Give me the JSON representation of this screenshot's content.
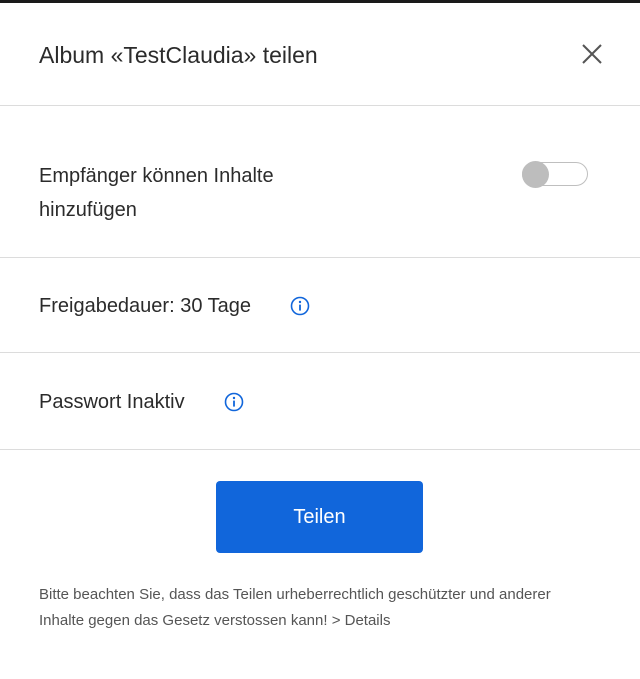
{
  "dialog": {
    "title": "Album «TestClaudia» teilen",
    "close_icon": "close-icon"
  },
  "options": {
    "contributors": {
      "label": "Empfänger können Inhalte hinzufügen",
      "toggle_on": false
    },
    "duration": {
      "label": "Freigabedauer: 30 Tage",
      "icon": "info-icon"
    },
    "password": {
      "label": "Passwort Inaktiv",
      "icon": "info-icon"
    }
  },
  "actions": {
    "share_label": "Teilen"
  },
  "notice": {
    "text": "Bitte beachten Sie, dass das Teilen urheberrechtlich geschützter und anderer Inhalte gegen das Gesetz verstossen kann! ",
    "link_label": "> Details"
  },
  "colors": {
    "primary": "#1166db",
    "divider": "#dcdcdc",
    "toggle_off": "#bdbdbd",
    "info_icon": "#1166db"
  }
}
